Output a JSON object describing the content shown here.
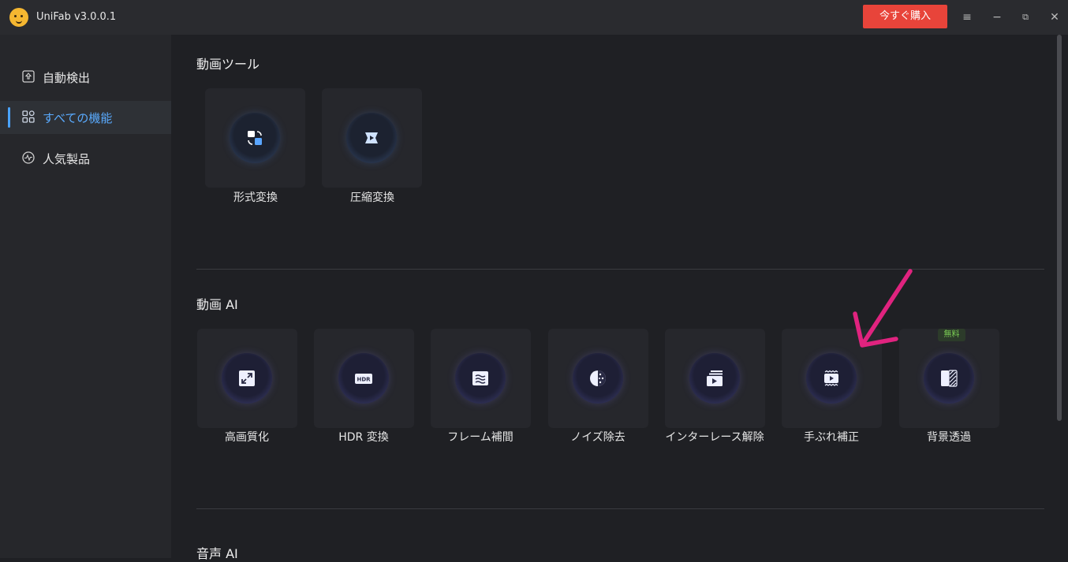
{
  "app": {
    "title": "UniFab v3.0.0.1",
    "buy_label": "今すぐ購入"
  },
  "window_controls": {
    "menu": "≡",
    "minimize": "−",
    "restore": "⧉",
    "close": "✕"
  },
  "sidebar": {
    "items": [
      {
        "label": "自動検出",
        "icon": "upload-icon"
      },
      {
        "label": "すべての機能",
        "icon": "grid-icon",
        "active": true
      },
      {
        "label": "人気製品",
        "icon": "wave-icon"
      }
    ]
  },
  "sections": {
    "video_tools": {
      "title": "動画ツール",
      "cards": [
        {
          "label": "形式変換",
          "icon": "convert-icon"
        },
        {
          "label": "圧縮変換",
          "icon": "compress-icon"
        }
      ]
    },
    "video_ai": {
      "title": "動画 AI",
      "cards": [
        {
          "label": "高画質化",
          "icon": "upscale-icon"
        },
        {
          "label": "HDR 変換",
          "icon": "hdr-icon",
          "icon_text": "HDR"
        },
        {
          "label": "フレーム補間",
          "icon": "frame-interpolation-icon"
        },
        {
          "label": "ノイズ除去",
          "icon": "denoise-icon"
        },
        {
          "label": "インターレース解除",
          "icon": "deinterlace-icon"
        },
        {
          "label": "手ぶれ補正",
          "icon": "stabilize-icon"
        },
        {
          "label": "背景透過",
          "icon": "background-removal-icon",
          "badge": "無料"
        }
      ]
    },
    "audio_ai": {
      "title": "音声 AI"
    }
  },
  "colors": {
    "accent": "#4aa3ff",
    "buy": "#e8443a",
    "annotation_arrow": "#e0237f",
    "badge_text": "#7ccf55"
  }
}
